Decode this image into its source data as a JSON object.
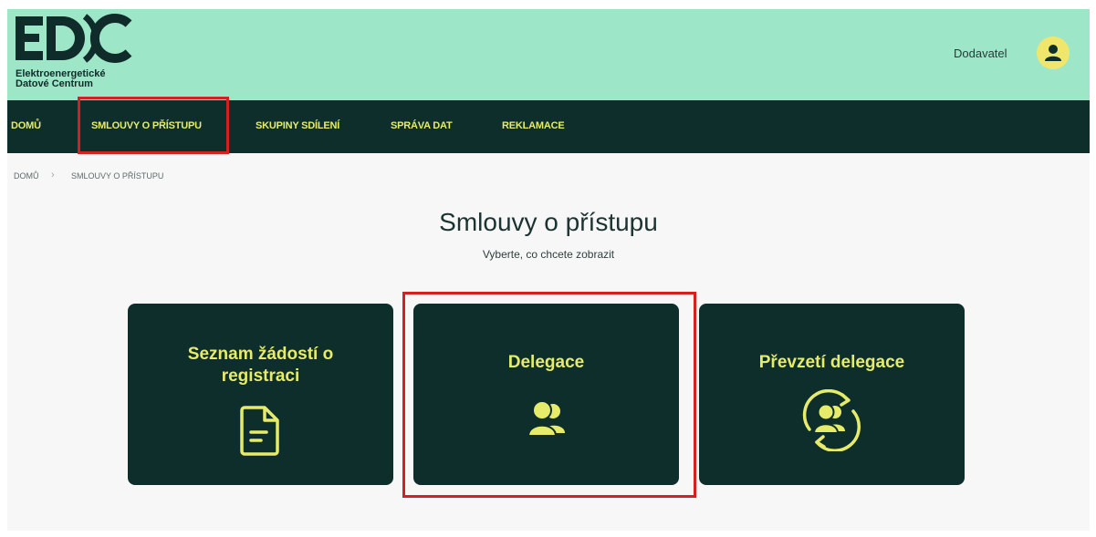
{
  "header": {
    "logo": {
      "mark": "EDC",
      "line1": "Elektroenergetické",
      "line2": "Datové Centrum"
    },
    "user_name": "Dodavatel",
    "avatar_icon": "user-icon"
  },
  "nav": {
    "items": [
      {
        "label": "DOMŮ"
      },
      {
        "label": "SMLOUVY O PŘÍSTUPU",
        "active": true
      },
      {
        "label": "SKUPINY SDÍLENÍ"
      },
      {
        "label": "SPRÁVA DAT"
      },
      {
        "label": "REKLAMACE"
      }
    ]
  },
  "breadcrumb": {
    "items": [
      {
        "label": "DOMŮ"
      },
      {
        "label": "SMLOUVY O PŘÍSTUPU"
      }
    ],
    "separator_icon": "chevron-right-icon"
  },
  "main": {
    "title": "Smlouvy o přístupu",
    "subtitle": "Vyberte, co chcete zobrazit",
    "cards": [
      {
        "line1": "Seznam žádostí o",
        "line2": "registraci",
        "icon": "document-icon"
      },
      {
        "line1": "Delegace",
        "icon": "users-icon",
        "highlighted": true
      },
      {
        "line1": "Převzetí delegace",
        "icon": "users-transfer-icon"
      }
    ]
  },
  "colors": {
    "header_bg": "#9ee6c8",
    "nav_bg": "#0e2e2b",
    "accent_yellow": "#e6ec6a",
    "highlight_red": "#d42020"
  }
}
